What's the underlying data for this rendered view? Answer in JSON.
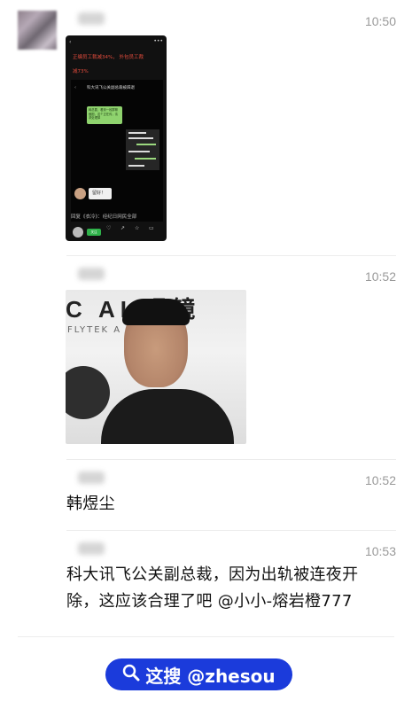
{
  "messages": [
    {
      "time": "10:50",
      "type": "image",
      "label": "screenshot",
      "phone_text": {
        "line1": "正编员工裁减34%， 外包员工裁",
        "line2": "减73%",
        "inner_title": "科大讯飞公关副总裁被辞退",
        "bubble": "韩总要，看到一段群聊截图，这个正在传，请求处理掉",
        "ok": "留好！",
        "caption": "回复《衣冷》：经纪日网民全部",
        "follow": "关注"
      }
    },
    {
      "time": "10:52",
      "type": "image",
      "label": "photo",
      "photo_text": "C AI 眼镜",
      "photo_sub": "FLYTEK A"
    },
    {
      "time": "10:52",
      "type": "text",
      "text": "韩煜尘"
    },
    {
      "time": "10:53",
      "type": "text",
      "lines": [
        "科大讯飞公关副总裁，因为出轨被连夜开",
        "除，这应该合理了吧 @小小-熔岩橙777"
      ]
    }
  ],
  "watermark": {
    "icon": "search-icon",
    "text": "这搜 @zhesou",
    "color": "#1b3bdb"
  }
}
